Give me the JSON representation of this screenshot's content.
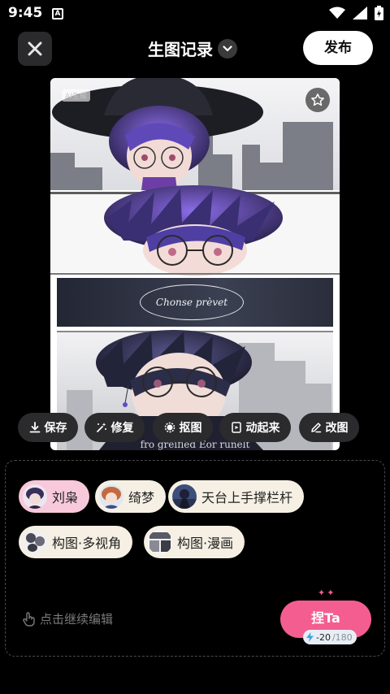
{
  "status_bar": {
    "time": "9:45",
    "notification_letter": "A",
    "icons": [
      "wifi-icon",
      "signal-icon",
      "battery-icon"
    ]
  },
  "header": {
    "close_icon": "close-icon",
    "title": "生图记录",
    "title_icon": "chevron-down-icon",
    "publish_label": "发布"
  },
  "artwork": {
    "watermark": "AI生成",
    "banner_text": "Chonse prèvet",
    "caption": "fro greified Eor runelt",
    "star_icon": "star-icon"
  },
  "actions": [
    {
      "label": "保存",
      "icon": "download-icon"
    },
    {
      "label": "修复",
      "icon": "sparkle-wand-icon"
    },
    {
      "label": "抠图",
      "icon": "cutout-icon"
    },
    {
      "label": "动起来",
      "icon": "animate-icon"
    },
    {
      "label": "改图",
      "icon": "edit-pen-icon"
    }
  ],
  "tags": [
    {
      "label": "刘枭",
      "active": true
    },
    {
      "label": "绮梦",
      "active": false
    },
    {
      "label": "天台上手撑栏杆",
      "active": false
    },
    {
      "label": "构图·多视角",
      "active": false
    },
    {
      "label": "构图·漫画",
      "active": false
    }
  ],
  "editor": {
    "continue_label": "点击继续编辑",
    "poke_label": "捏Ta",
    "sparkle": "✦✦",
    "credit_cost": "-20",
    "credit_total": "/180"
  },
  "colors": {
    "background": "#000000",
    "accent_pink": "#f45d8f",
    "tag_bg": "#f6f0e4",
    "tag_active_bg": "#f7c9da",
    "action_bg": "#2b2b2d"
  }
}
